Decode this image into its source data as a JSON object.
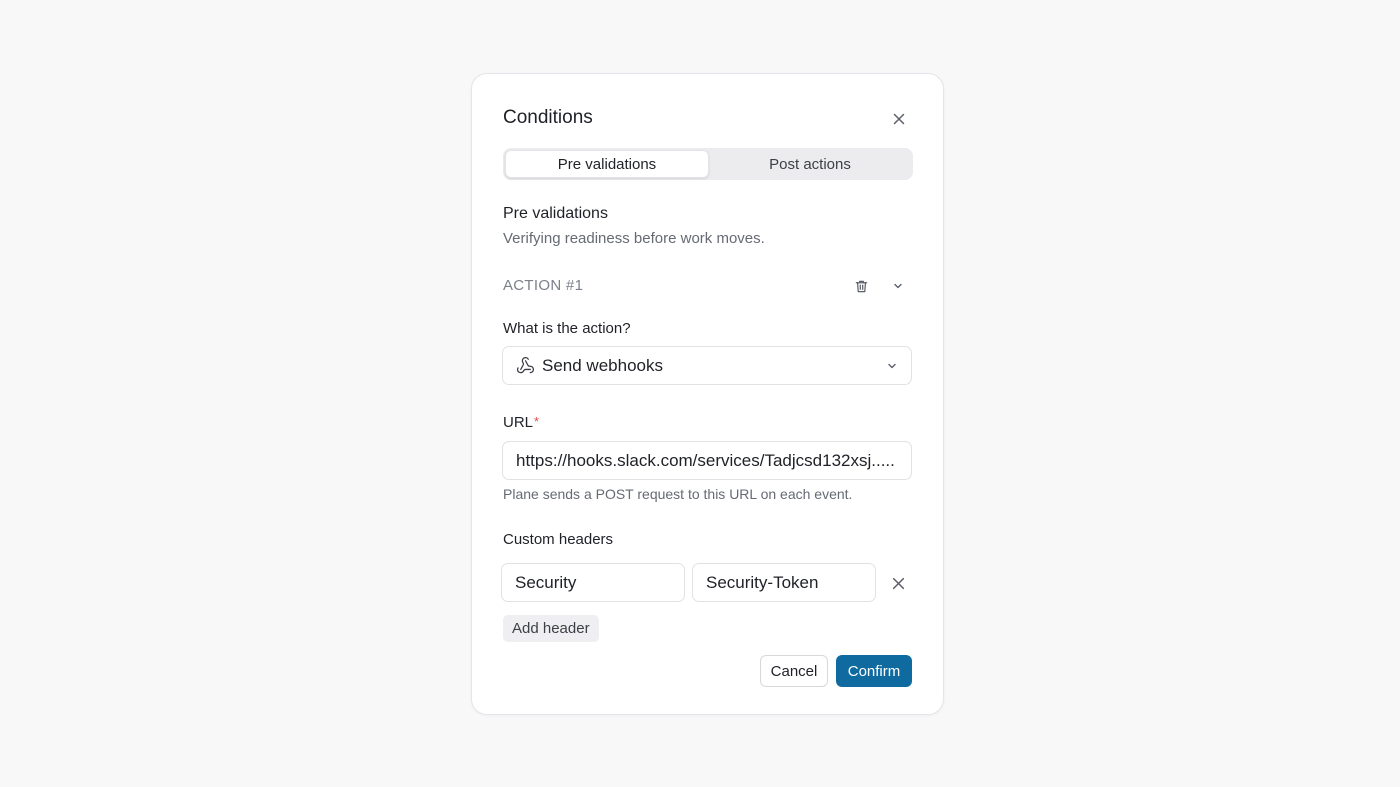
{
  "dialog": {
    "title": "Conditions",
    "close_icon": "close-icon"
  },
  "tabs": [
    {
      "label": "Pre validations",
      "active": true
    },
    {
      "label": "Post actions",
      "active": false
    }
  ],
  "section": {
    "title": "Pre validations",
    "description": "Verifying readiness before work moves."
  },
  "action": {
    "label": "ACTION #1",
    "delete_icon": "trash-icon",
    "collapse_icon": "chevron-down-icon",
    "question_label": "What is the action?",
    "selected_value": "Send webhooks",
    "selected_icon": "webhook-icon"
  },
  "url": {
    "label": "URL",
    "required_mark": "*",
    "value": "https://hooks.slack.com/services/Tadjcsd132xsj.....",
    "hint": "Plane sends a POST request to this URL on each event."
  },
  "headers": {
    "label": "Custom headers",
    "rows": [
      {
        "key": "Security",
        "value": "Security-Token"
      }
    ],
    "add_label": "Add header"
  },
  "footer": {
    "cancel_label": "Cancel",
    "confirm_label": "Confirm"
  },
  "colors": {
    "accent": "#0f6aa0",
    "required": "#e5484d",
    "background": "#f8f8f9"
  }
}
